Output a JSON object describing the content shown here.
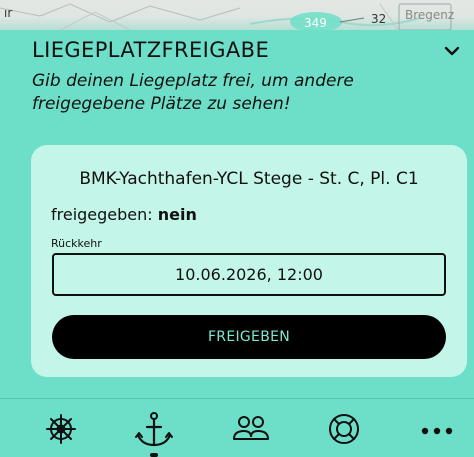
{
  "map": {
    "labels": [
      "ır",
      "349",
      "32",
      "Bregenz"
    ]
  },
  "sheet": {
    "title": "LIEGEPLATZFREIGABE",
    "subtitle": "Gib deinen Liegeplatz frei, um andere freigegebene Plätze zu sehen!",
    "collapse_icon": "chevron-down-icon"
  },
  "card": {
    "berth_name": "BMK-Yachthafen-YCL Stege - St. C, Pl. C1",
    "status_label": "freigegeben:",
    "status_value": "nein",
    "return_label": "Rückkehr",
    "return_value": "10.06.2026, 12:00",
    "release_button": "FREIGEBEN"
  },
  "tabbar": {
    "tabs": [
      {
        "icon": "ship-wheel-icon",
        "active": false
      },
      {
        "icon": "anchor-icon",
        "active": true
      },
      {
        "icon": "people-icon",
        "active": false
      },
      {
        "icon": "lifebuoy-icon",
        "active": false
      },
      {
        "icon": "more-dots-icon",
        "active": false
      }
    ]
  },
  "colors": {
    "background": "#6ddfc8",
    "card": "#c3f5e9",
    "button": "#000000",
    "button_text": "#7fe8d2"
  }
}
